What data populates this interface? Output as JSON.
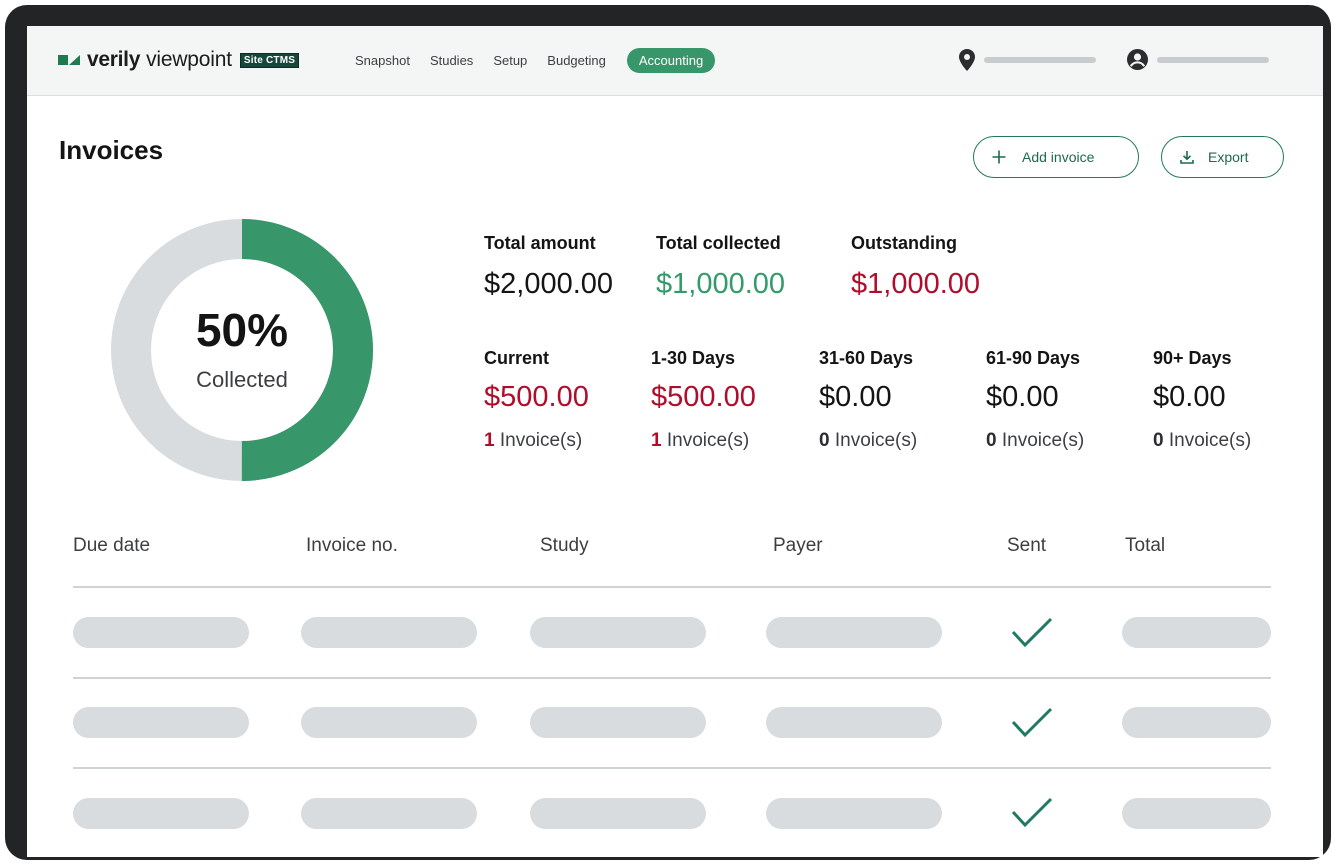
{
  "app": {
    "brand_primary": "verily",
    "brand_secondary": "viewpoint",
    "brand_badge": "Site CTMS",
    "accent_color": "#37966a",
    "danger_color": "#b00d2b"
  },
  "nav": {
    "items": [
      {
        "label": "Snapshot",
        "active": false
      },
      {
        "label": "Studies",
        "active": false
      },
      {
        "label": "Setup",
        "active": false
      },
      {
        "label": "Budgeting",
        "active": false
      },
      {
        "label": "Accounting",
        "active": true
      }
    ]
  },
  "header_icons": {
    "location": "location-pin-icon",
    "user": "user-avatar-icon"
  },
  "page": {
    "title": "Invoices",
    "add_label": "Add invoice",
    "export_label": "Export"
  },
  "summary": {
    "percent_collected": "50%",
    "collected_fraction": 0.5,
    "collected_label": "Collected",
    "total_amount_label": "Total amount",
    "total_amount": "$2,000.00",
    "total_collected_label": "Total collected",
    "total_collected": "$1,000.00",
    "outstanding_label": "Outstanding",
    "outstanding": "$1,000.00"
  },
  "aging": [
    {
      "label": "Current",
      "amount": "$500.00",
      "count": "1",
      "count_suffix": " Invoice(s)",
      "overdue": true
    },
    {
      "label": "1-30 Days",
      "amount": "$500.00",
      "count": "1",
      "count_suffix": " Invoice(s)",
      "overdue": true
    },
    {
      "label": "31-60 Days",
      "amount": "$0.00",
      "count": "0",
      "count_suffix": " Invoice(s)",
      "overdue": false
    },
    {
      "label": "61-90 Days",
      "amount": "$0.00",
      "count": "0",
      "count_suffix": " Invoice(s)",
      "overdue": false
    },
    {
      "label": "90+ Days",
      "amount": "$0.00",
      "count": "0",
      "count_suffix": " Invoice(s)",
      "overdue": false
    }
  ],
  "table": {
    "columns": [
      "Due date",
      "Invoice no.",
      "Study",
      "Payer",
      "Sent",
      "Total"
    ],
    "rows": [
      {
        "sent": true
      },
      {
        "sent": true
      },
      {
        "sent": true
      }
    ]
  }
}
